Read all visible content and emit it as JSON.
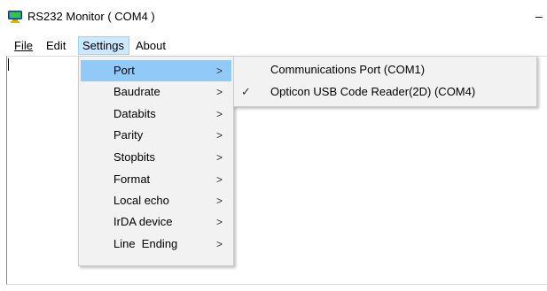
{
  "window": {
    "title": "RS232 Monitor ( COM4 )",
    "minimize_glyph": "–"
  },
  "menubar": {
    "file": "File",
    "edit": "Edit",
    "settings": "Settings",
    "about": "About"
  },
  "settings_menu": {
    "items": [
      {
        "label": "Port",
        "arrow": ">",
        "highlighted": true
      },
      {
        "label": "Baudrate",
        "arrow": ">"
      },
      {
        "label": "Databits",
        "arrow": ">"
      },
      {
        "label": "Parity",
        "arrow": ">"
      },
      {
        "label": "Stopbits",
        "arrow": ">"
      },
      {
        "label": "Format",
        "arrow": ">"
      },
      {
        "label": "Local echo",
        "arrow": ">"
      },
      {
        "label": "IrDA device",
        "arrow": ">"
      },
      {
        "label": "Line  Ending",
        "arrow": ">"
      }
    ]
  },
  "port_submenu": {
    "items": [
      {
        "label": "Communications Port (COM1)",
        "checked": false,
        "check": ""
      },
      {
        "label": "Opticon USB Code Reader(2D) (COM4)",
        "checked": true,
        "check": "✓"
      }
    ]
  },
  "colors": {
    "highlight": "#91c9f7",
    "menu_bg": "#f2f2f2",
    "menubar_active": "#cce8ff"
  }
}
